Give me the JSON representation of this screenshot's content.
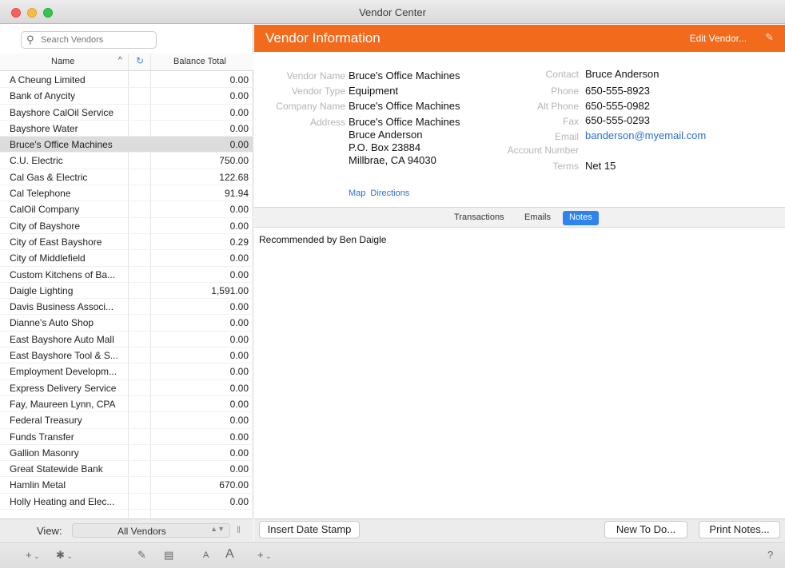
{
  "window": {
    "title": "Vendor Center"
  },
  "sidebar": {
    "search_placeholder": "Search Vendors",
    "header": {
      "name": "Name",
      "sort": "^",
      "balance": "Balance Total"
    },
    "vendors": [
      {
        "name": "A Cheung Limited",
        "balance": "0.00"
      },
      {
        "name": "Bank of Anycity",
        "balance": "0.00"
      },
      {
        "name": "Bayshore CalOil Service",
        "balance": "0.00"
      },
      {
        "name": "Bayshore Water",
        "balance": "0.00"
      },
      {
        "name": "Bruce's Office Machines",
        "balance": "0.00",
        "selected": true
      },
      {
        "name": "C.U. Electric",
        "balance": "750.00"
      },
      {
        "name": "Cal Gas & Electric",
        "balance": "122.68"
      },
      {
        "name": "Cal Telephone",
        "balance": "91.94"
      },
      {
        "name": "CalOil Company",
        "balance": "0.00"
      },
      {
        "name": "City of Bayshore",
        "balance": "0.00"
      },
      {
        "name": "City of East Bayshore",
        "balance": "0.29"
      },
      {
        "name": "City of Middlefield",
        "balance": "0.00"
      },
      {
        "name": "Custom Kitchens of Ba...",
        "balance": "0.00"
      },
      {
        "name": "Daigle Lighting",
        "balance": "1,591.00"
      },
      {
        "name": "Davis Business Associ...",
        "balance": "0.00"
      },
      {
        "name": "Dianne's Auto Shop",
        "balance": "0.00"
      },
      {
        "name": "East Bayshore Auto Mall",
        "balance": "0.00"
      },
      {
        "name": "East Bayshore Tool & S...",
        "balance": "0.00"
      },
      {
        "name": "Employment Developm...",
        "balance": "0.00"
      },
      {
        "name": "Express Delivery Service",
        "balance": "0.00"
      },
      {
        "name": "Fay, Maureen Lynn, CPA",
        "balance": "0.00"
      },
      {
        "name": "Federal Treasury",
        "balance": "0.00"
      },
      {
        "name": "Funds Transfer",
        "balance": "0.00"
      },
      {
        "name": "Gallion Masonry",
        "balance": "0.00"
      },
      {
        "name": "Great Statewide Bank",
        "balance": "0.00"
      },
      {
        "name": "Hamlin Metal",
        "balance": "670.00"
      },
      {
        "name": "Holly Heating and Elec...",
        "balance": "0.00"
      }
    ],
    "view_label": "View:",
    "view_value": "All Vendors"
  },
  "vendor_info": {
    "header_title": "Vendor Information",
    "edit_label": "Edit Vendor...",
    "labels": {
      "vendor_name": "Vendor Name",
      "vendor_type": "Vendor Type",
      "company_name": "Company Name",
      "address": "Address",
      "contact": "Contact",
      "phone": "Phone",
      "alt_phone": "Alt Phone",
      "fax": "Fax",
      "email": "Email",
      "account_number": "Account Number",
      "terms": "Terms"
    },
    "values": {
      "vendor_name": "Bruce's Office Machines",
      "vendor_type": "Equipment",
      "company_name": "Bruce's Office Machines",
      "address_line1": "Bruce's Office Machines",
      "address_line2": "Bruce Anderson",
      "address_line3": "P.O. Box 23884",
      "address_line4": "Millbrae, CA 94030",
      "contact": "Bruce Anderson",
      "phone": "650-555-8923",
      "alt_phone": "650-555-0982",
      "fax": "650-555-0293",
      "email": "banderson@myemail.com",
      "terms": "Net 15"
    },
    "map_link": "Map",
    "directions_link": "Directions"
  },
  "tabs": [
    {
      "label": "Transactions",
      "active": false
    },
    {
      "label": "Emails",
      "active": false
    },
    {
      "label": "Notes",
      "active": true
    }
  ],
  "notes": {
    "text": "Recommended by Ben Daigle"
  },
  "actions": {
    "insert_date_stamp": "Insert Date Stamp",
    "new_todo": "New To Do...",
    "print_notes": "Print Notes..."
  },
  "toolbar": {
    "add": "+",
    "gear": "✱",
    "edit": "✎",
    "columns": "▤",
    "font_small": "A",
    "font_large": "A",
    "add2": "+",
    "help": "?"
  }
}
